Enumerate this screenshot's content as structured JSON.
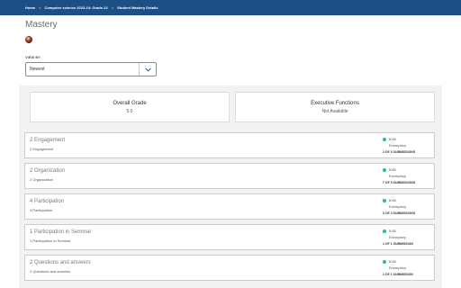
{
  "breadcrumb": {
    "home": "Home",
    "course": "Computer science 2023-24: Grade-12",
    "current": "Student Mastery Details",
    "separator": ">"
  },
  "page": {
    "title": "Mastery"
  },
  "view_by": {
    "label": "VIEW BY",
    "selected": "Newest"
  },
  "summary": {
    "overall_grade_label": "Overall Grade",
    "overall_grade_value": "5.0",
    "executive_functions_label": "Executive Functions",
    "executive_functions_value": "Not Available"
  },
  "colors": {
    "topbar": "#1c4f86",
    "status_dot": "#2bb5a3"
  },
  "items": [
    {
      "name": "2 Engagement",
      "sub": "2 Engagement",
      "score": "5.00",
      "level": "Exemplary",
      "submissions": "2 OF 3 SUBMISSIONS"
    },
    {
      "name": "2 Organization",
      "sub": "2 Organization",
      "score": "5.00",
      "level": "Exemplary",
      "submissions": "7 OF 9 SUBMISSIONS"
    },
    {
      "name": "4 Participation",
      "sub": "4 Participation",
      "score": "5.00",
      "level": "Exemplary",
      "submissions": "3 OF 4 SUBMISSIONS"
    },
    {
      "name": "1 Participation in Seminar",
      "sub": "1 Participation in Seminar",
      "score": "5.00",
      "level": "Exemplary",
      "submissions": "1 OF 1 SUBMISSION"
    },
    {
      "name": "2 Questions and answers",
      "sub": "2 Questions and answers",
      "score": "5.00",
      "level": "Exemplary",
      "submissions": "1 OF 1 SUBMISSION"
    }
  ]
}
